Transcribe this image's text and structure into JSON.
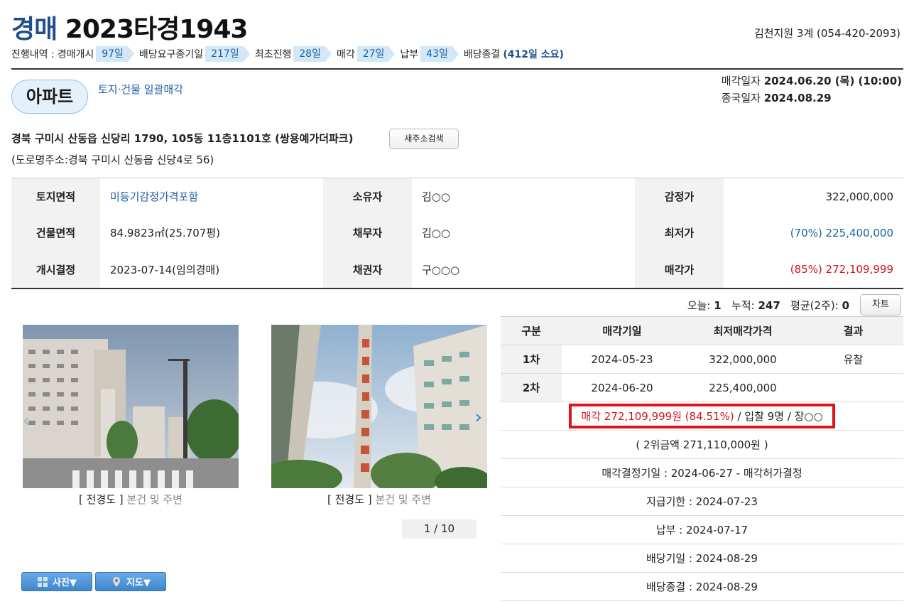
{
  "header": {
    "kind": "경매",
    "case_no": "2023타경1943",
    "court": "김천지원 3계 (054-420-2093)"
  },
  "progress": {
    "label": "진행내역 : ",
    "steps": [
      {
        "name": "경매개시",
        "days": "97일"
      },
      {
        "name": "배당요구종기일",
        "days": "217일"
      },
      {
        "name": "최초진행",
        "days": "28일"
      },
      {
        "name": "매각",
        "days": "27일"
      },
      {
        "name": "납부",
        "days": "43일"
      }
    ],
    "end_label": "배당종결",
    "total": "(412일 소요)"
  },
  "property": {
    "type": "아파트",
    "sale_method": "토지·건물 일괄매각",
    "sale_date_label": "매각일자 ",
    "sale_date": "2024.06.20 (목) (10:00)",
    "end_date_label": "종국일자 ",
    "end_date": "2024.08.29",
    "address": "경북 구미시 산동읍 신당리 1790, 105동 11층1101호 (쌍용예가더파크)",
    "new_address_button": "새주소검색",
    "road_address": "(도로명주소:경북 구미시 산동읍 신당4로 56)"
  },
  "info": {
    "land_area_label": "토지면적",
    "land_area": "미등기감정가격포함",
    "owner_label": "소유자",
    "owner": "김○○",
    "appraisal_label": "감정가",
    "appraisal": "322,000,000",
    "building_area_label": "건물면적",
    "building_area": "84.9823㎡(25.707평)",
    "debtor_label": "채무자",
    "debtor": "김○○",
    "min_price_label": "최저가",
    "min_price": "(70%) 225,400,000",
    "start_label": "개시결정",
    "start": "2023-07-14(임의경매)",
    "creditor_label": "채권자",
    "creditor": "구○○○",
    "sold_price_label": "매각가",
    "sold_price": "(85%) 272,109,999"
  },
  "counter": {
    "today_label": "오늘: ",
    "today": "1",
    "total_label": "누적: ",
    "total": "247",
    "avg_label": "평균(2주): ",
    "avg": "0",
    "chart_button": "차트"
  },
  "photos": [
    {
      "bracket": "[ 전경도 ]",
      "desc": "본건 및 주변"
    },
    {
      "bracket": "[ 전경도 ]",
      "desc": "본건 및 주변"
    }
  ],
  "pager": "1 / 10",
  "buttons": {
    "photo": "사진▼",
    "map": "지도▼"
  },
  "history": {
    "headers": [
      "구분",
      "매각기일",
      "최저매각가격",
      "결과"
    ],
    "rows": [
      {
        "round": "1차",
        "date": "2024-05-23",
        "price": "322,000,000",
        "result": "유찰"
      },
      {
        "round": "2차",
        "date": "2024-06-20",
        "price": "225,400,000",
        "result": ""
      }
    ],
    "sale_result_red": "매각 272,109,999원 (84.51%)",
    "sale_result_rest": " / 입찰 9명 / 장○○",
    "second_bid": "( 2위금액 271,110,000원 )",
    "decision": "매각결정기일 : 2024-06-27 - 매각허가결정",
    "payment_deadline": "지급기한 : 2024-07-23",
    "paid": "납부 : 2024-07-17",
    "dividend_date": "배당기일 : 2024-08-29",
    "dividend_end": "배당종결 : 2024-08-29"
  },
  "colors": {
    "accent_blue": "#1f4e8c",
    "link_blue": "#1f5fa0",
    "highlight_red": "#d0141c",
    "badge_bg": "#e4f1fb"
  }
}
